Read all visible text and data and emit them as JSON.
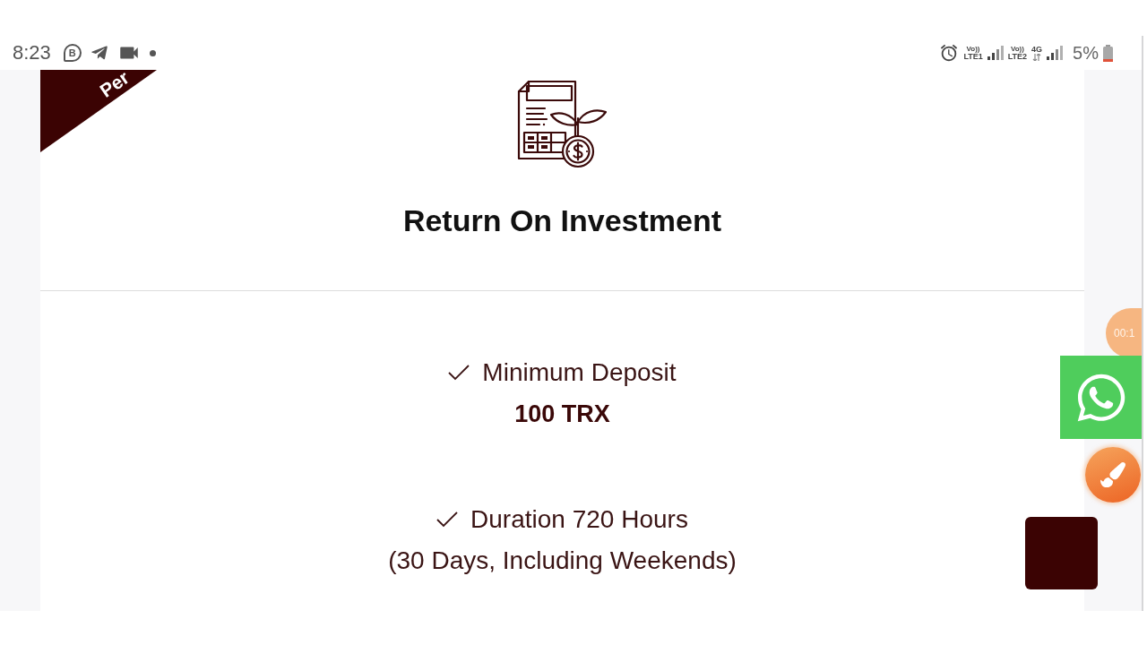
{
  "status_bar": {
    "time": "8:23",
    "chat_badge_letter": "B",
    "sim_1": {
      "volte": "Vo))",
      "network": "LTE1"
    },
    "sim_2": {
      "volte": "Vo))",
      "network": "LTE2",
      "data": "4G"
    },
    "battery": "5%"
  },
  "plan_card": {
    "ribbon_text": "Per",
    "title": "Return On Investment",
    "features": [
      {
        "kind": "amount",
        "label": "Minimum Deposit",
        "value": "100 TRX"
      },
      {
        "kind": "note",
        "label": "Duration 720 Hours",
        "value": "(30 Days, Including Weekends)"
      }
    ]
  },
  "recorder_bubble": {
    "timer": "00:1"
  }
}
